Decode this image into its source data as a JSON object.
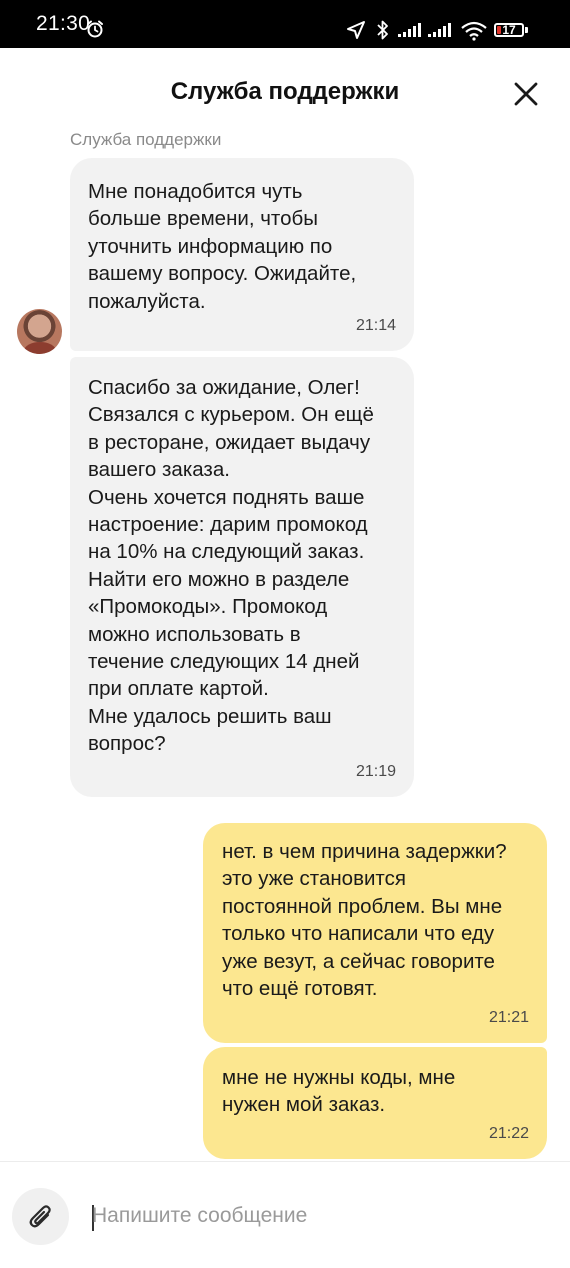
{
  "status_bar": {
    "time": "21:30",
    "battery": "17",
    "battery_level": 0.17,
    "icons": [
      "alarm-icon",
      "navigation-icon",
      "bluetooth-icon",
      "signal-icon",
      "signal-icon",
      "wifi-icon",
      "battery-icon"
    ]
  },
  "header": {
    "title": "Служба поддержки",
    "close_icon": "close-icon"
  },
  "chat": {
    "sender_name": "Служба поддержки",
    "messages": [
      {
        "direction": "incoming",
        "text": "Мне понадобится чуть\nбольше времени, чтобы\nуточнить информацию по\nвашему вопросу. Ожидайте,\nпожалуйста.",
        "time": "21:14"
      },
      {
        "direction": "incoming",
        "text": "Спасибо за ожидание, Олег!\nСвязался с курьером. Он ещё\nв ресторане, ожидает выдачу\nвашего заказа.\nОчень хочется поднять ваше\nнастроение: дарим промокод\nна 10% на следующий заказ.\nНайти его можно в разделе\n«Промокоды». Промокод\nможно использовать в\nтечение следующих 14 дней\nпри оплате картой.\nМне удалось решить ваш\nвопрос?",
        "time": "21:19"
      },
      {
        "direction": "outgoing",
        "text": "нет. в чем причина задержки?\nэто уже становится\nпостоянной проблем. Вы мне\nтолько что написали что еду\nуже везут, а сейчас говорите\nчто ещё готовят.",
        "time": "21:21"
      },
      {
        "direction": "outgoing",
        "text": "мне не нужны коды, мне\nнужен мой заказ.",
        "time": "21:22"
      }
    ]
  },
  "composer": {
    "placeholder": "Напишите сообщение",
    "value": "",
    "attach_icon": "paperclip-icon"
  },
  "colors": {
    "incoming_bubble": "#f2f2f2",
    "outgoing_bubble": "#fce790",
    "status_bar": "#000000",
    "battery_low": "#e0352b"
  }
}
